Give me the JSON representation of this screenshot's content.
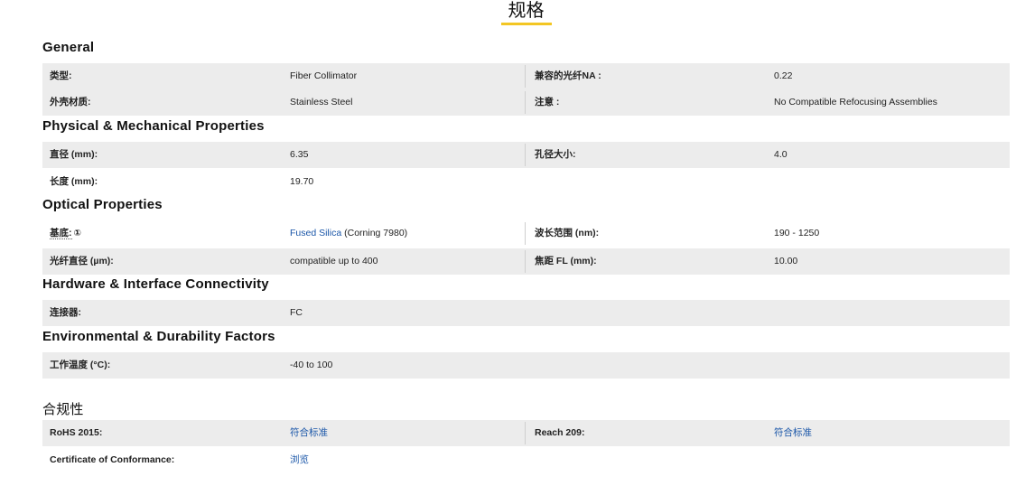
{
  "page_title": "规格",
  "sections": {
    "general": "General",
    "physical": "Physical & Mechanical Properties",
    "optical": "Optical Properties",
    "hardware": "Hardware & Interface Connectivity",
    "environmental": "Environmental & Durability Factors",
    "compliance": "合规性"
  },
  "general": {
    "type_label": "类型:",
    "type_value": "Fiber Collimator",
    "na_label": "兼容的光纤NA :",
    "na_value": "0.22",
    "housing_label": "外壳材质:",
    "housing_value": "Stainless Steel",
    "note_label": "注意 :",
    "note_value": "No Compatible Refocusing Assemblies"
  },
  "physical": {
    "diameter_label": "直径 (mm):",
    "diameter_value": "6.35",
    "aperture_label": "孔径大小:",
    "aperture_value": "4.0",
    "length_label": "长度 (mm):",
    "length_value": "19.70"
  },
  "optical": {
    "substrate_label": "基底:",
    "substrate_icon": "①",
    "substrate_link": "Fused Silica",
    "substrate_suffix": "(Corning 7980)",
    "wavelength_label": "波长范围 (nm):",
    "wavelength_value": "190 - 1250",
    "fiber_diameter_label": "光纤直径 (µm):",
    "fiber_diameter_value": "compatible up to 400",
    "focal_label": "焦距 FL (mm):",
    "focal_value": "10.00"
  },
  "hardware": {
    "connector_label": "连接器:",
    "connector_value": "FC"
  },
  "environmental": {
    "temp_label": "工作温度 (°C):",
    "temp_value": "-40 to 100"
  },
  "compliance": {
    "rohs_label": "RoHS 2015:",
    "rohs_value": "符合标准",
    "reach_label": "Reach 209:",
    "reach_value": "符合标准",
    "coc_label": "Certificate of Conformance:",
    "coc_value": "浏览"
  },
  "colors": {
    "accent_underline": "#f3c623",
    "row_shade": "#ececec",
    "link": "#1a56a8"
  }
}
